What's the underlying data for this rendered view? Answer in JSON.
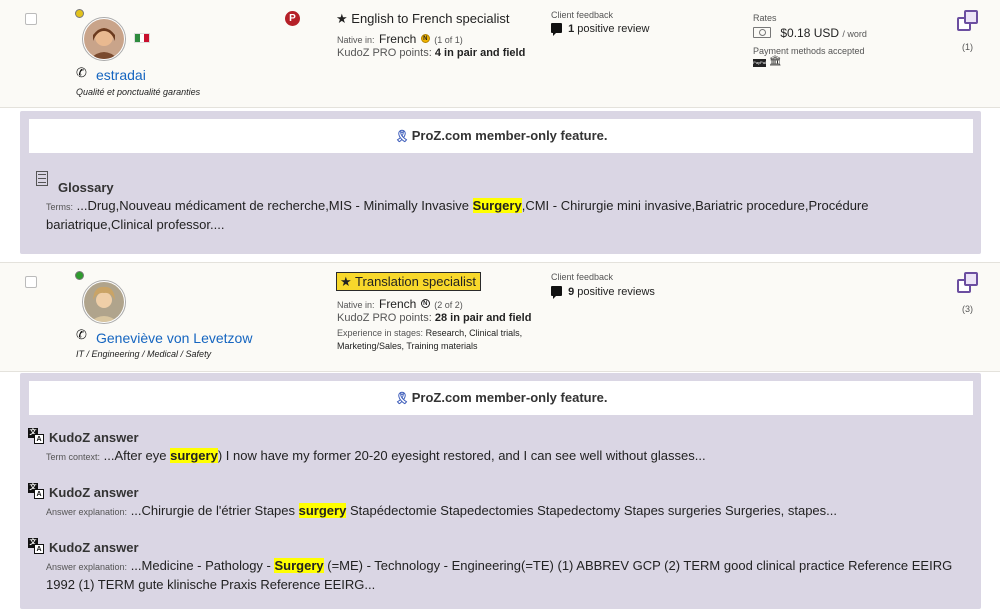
{
  "colors": {
    "row_bg": "#fbfaf6",
    "panel_bg": "#dad6e4",
    "link_blue": "#1565c0",
    "highlight_yellow": "#ffff00",
    "spec_badge_yellow": "#f8d82b",
    "status_yellow": "#e2c21c",
    "status_green": "#2e9b2e",
    "pro_red": "#b52028",
    "compare_purple": "#6b4ea0",
    "ribbon_blue": "#3a5ab9"
  },
  "results": [
    {
      "status_color": "#e2c21c",
      "username": "estradai",
      "tagline": "Qualité et ponctualité garanties",
      "has_flag": true,
      "has_pro_badge": true,
      "pro_badge_letter": "P",
      "specialty_prefix": "★",
      "specialty": "English to French specialist",
      "native_label": "Native in:",
      "native_language": "French",
      "native_badge": "N",
      "native_count": "(1 of 1)",
      "kudoz_label": "KudoZ PRO points:",
      "kudoz_value": "4 in pair and field",
      "feedback_label": "Client feedback",
      "feedback_count": "1",
      "feedback_text": "positive review",
      "rates_label": "Rates",
      "rate_value": "$0.18 USD",
      "rate_unit": "/ word",
      "payment_label": "Payment methods accepted",
      "paypal_text": "PayPal",
      "compare_count": "(1)"
    },
    {
      "status_color": "#2e9b2e",
      "username": "Geneviève von Levetzow",
      "tagline": "IT / Engineering / Medical / Safety",
      "specialty_prefix": "★",
      "specialty": "Translation specialist",
      "native_label": "Native in:",
      "native_language": "French",
      "native_badge": "N",
      "native_count": "(2 of 2)",
      "kudoz_label": "KudoZ PRO points:",
      "kudoz_value": "28 in pair and field",
      "experience_label": "Experience in stages:",
      "experience_value_line1": "Research, Clinical trials,",
      "experience_value_line2": "Marketing/Sales, Training materials",
      "feedback_label": "Client feedback",
      "feedback_count": "9",
      "feedback_text": "positive reviews",
      "compare_count": "(3)"
    }
  ],
  "panels": [
    {
      "member_feature": "ProZ.com member-only feature.",
      "entries": [
        {
          "icon": "glossary-icon",
          "title": "Glossary",
          "label": "Terms:",
          "text_before": "...Drug,Nouveau médicament de recherche,MIS - Minimally Invasive ",
          "highlight": "Surgery",
          "text_after": ",CMI - Chirurgie mini invasive,Bariatric procedure,Procédure bariatrique,Clinical professor...."
        }
      ]
    },
    {
      "member_feature": "ProZ.com member-only feature.",
      "entries": [
        {
          "icon": "kudoz-translate-icon",
          "title": "KudoZ answer",
          "label": "Term context:",
          "text_before": "...After eye ",
          "highlight": "surgery",
          "text_after": ") I now have my former 20-20 eyesight restored, and I can see well without glasses..."
        },
        {
          "icon": "kudoz-translate-icon",
          "title": "KudoZ answer",
          "label": "Answer explanation:",
          "text_before": "...Chirurgie de l'étrier Stapes ",
          "highlight": "surgery",
          "text_after": " Stapédectomie Stapedectomies Stapedectomy Stapes surgeries Surgeries, stapes..."
        },
        {
          "icon": "kudoz-translate-icon",
          "title": "KudoZ answer",
          "label": "Answer explanation:",
          "text_before": "...Medicine - Pathology - ",
          "highlight": "Surgery",
          "text_after": " (=ME) - Technology - Engineering(=TE) (1) ABBREV GCP (2) TERM good clinical practice Reference EEIRG 1992 (1) TERM gute klinische Praxis Reference EEIRG..."
        }
      ]
    }
  ]
}
